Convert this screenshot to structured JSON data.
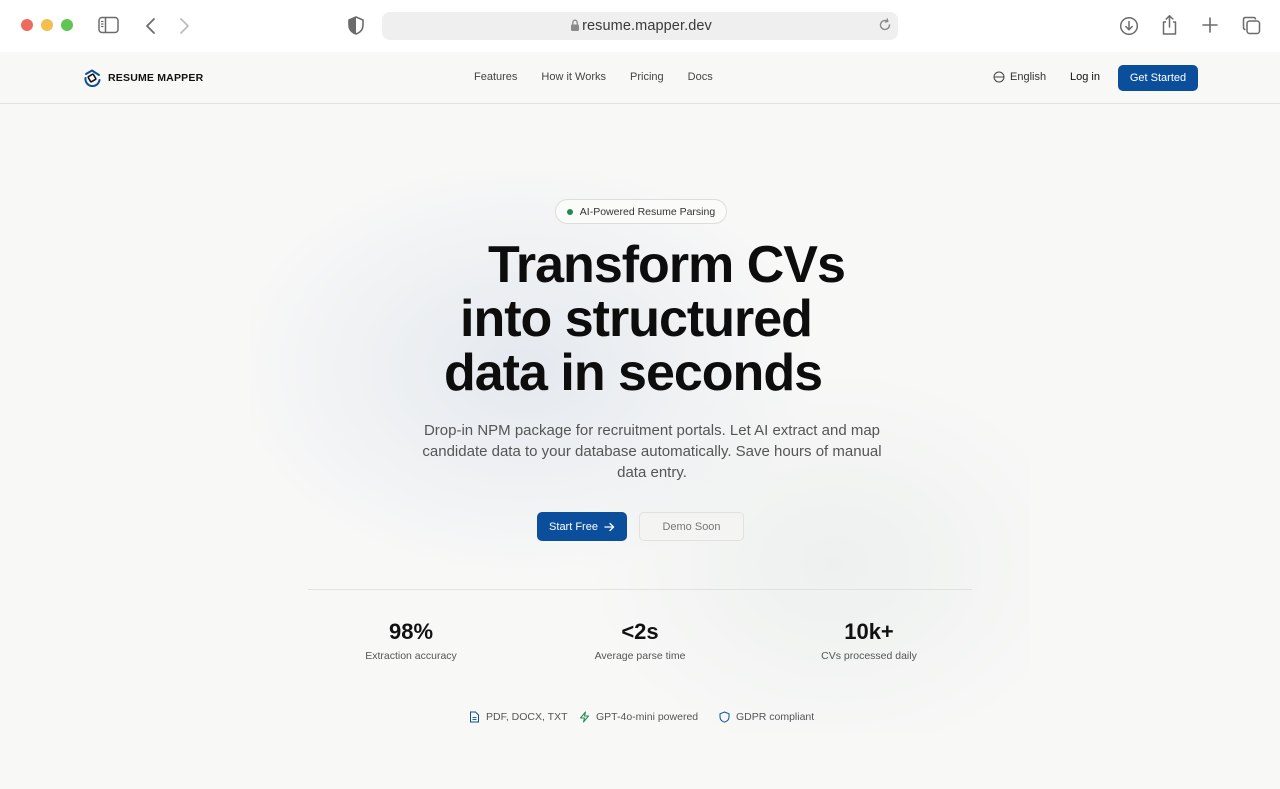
{
  "browser": {
    "url": "resume.mapper.dev"
  },
  "nav": {
    "brand": "RESUME MAPPER",
    "links": [
      "Features",
      "How it Works",
      "Pricing",
      "Docs"
    ],
    "language": "English",
    "login": "Log in",
    "cta": "Get Started"
  },
  "hero": {
    "badge": "AI-Powered Resume Parsing",
    "headline": [
      "Transform CVs",
      "into structured",
      "data in seconds"
    ],
    "subtext": "Drop-in NPM package for recruitment portals. Let AI extract and map candidate data to your database automatically. Save hours of manual data entry.",
    "primary_button": "Start Free",
    "secondary_button": "Demo Soon"
  },
  "stats": [
    {
      "value": "98%",
      "label": "Extraction accuracy"
    },
    {
      "value": "<2s",
      "label": "Average parse time"
    },
    {
      "value": "10k+",
      "label": "CVs processed daily"
    }
  ],
  "features": [
    {
      "label": "PDF, DOCX, TXT",
      "icon": "document-icon"
    },
    {
      "label": "GPT-4o-mini powered",
      "icon": "lightning-icon"
    },
    {
      "label": "GDPR compliant",
      "icon": "shield-icon"
    }
  ],
  "colors": {
    "primary": "#0b4f9c",
    "badge_dot": "#1e8b57",
    "page_bg": "#f8f8f7"
  }
}
